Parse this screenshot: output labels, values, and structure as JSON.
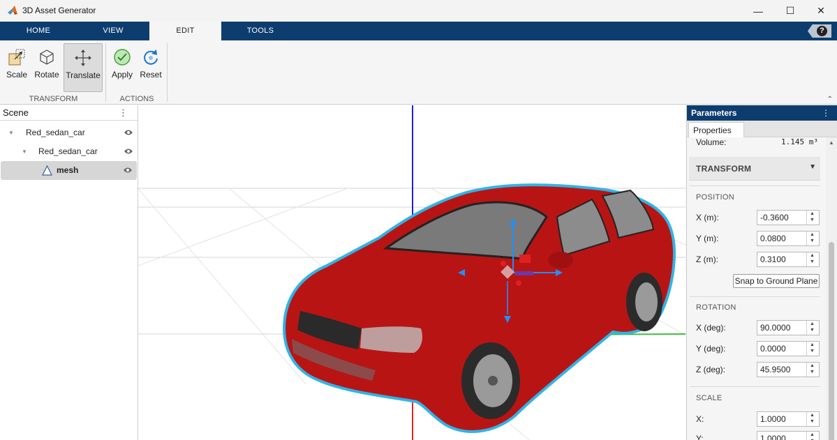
{
  "window": {
    "title": "3D Asset Generator",
    "minimize": "—",
    "maximize": "☐",
    "close": "✕"
  },
  "tabs": [
    {
      "label": "HOME"
    },
    {
      "label": "VIEW"
    },
    {
      "label": "EDIT"
    },
    {
      "label": "TOOLS"
    }
  ],
  "help": "?",
  "toolstrip": {
    "scale": "Scale",
    "rotate": "Rotate",
    "translate": "Translate",
    "apply": "Apply",
    "reset": "Reset",
    "transform_section": "TRANSFORM",
    "actions_section": "ACTIONS",
    "collapse": "⌃"
  },
  "scene": {
    "title": "Scene",
    "menu": "⋮",
    "items": [
      {
        "label": "Red_sedan_car"
      },
      {
        "label": "Red_sedan_car"
      },
      {
        "label": "mesh"
      }
    ]
  },
  "parameters": {
    "title": "Parameters",
    "menu": "⋮",
    "tab": "Properties",
    "volume_label": "Volume:",
    "volume_value": "1.145 m³",
    "transform_title": "TRANSFORM",
    "position_section": "POSITION",
    "x_m_label": "X (m):",
    "x_m_value": "-0.3600",
    "y_m_label": "Y (m):",
    "y_m_value": "0.0800",
    "z_m_label": "Z (m):",
    "z_m_value": "0.3100",
    "snap_button": "Snap to Ground Plane",
    "rotation_section": "ROTATION",
    "x_deg_label": "X (deg):",
    "x_deg_value": "90.0000",
    "y_deg_label": "Y (deg):",
    "y_deg_value": "0.0000",
    "z_deg_label": "Z (deg):",
    "z_deg_value": "45.9500",
    "scale_section": "SCALE",
    "scale_x_label": "X:",
    "scale_x_value": "1.0000",
    "scale_y_label": "Y:",
    "scale_y_value": "1.0000"
  },
  "colors": {
    "tabstrip": "#0d3d6e",
    "car_body": "#c01818",
    "selection_outline": "#2fb4e6",
    "axis_x": "#e02020",
    "axis_y": "#3fbf3f",
    "axis_z": "#2020d0",
    "gizmo": "#1e90ff"
  }
}
